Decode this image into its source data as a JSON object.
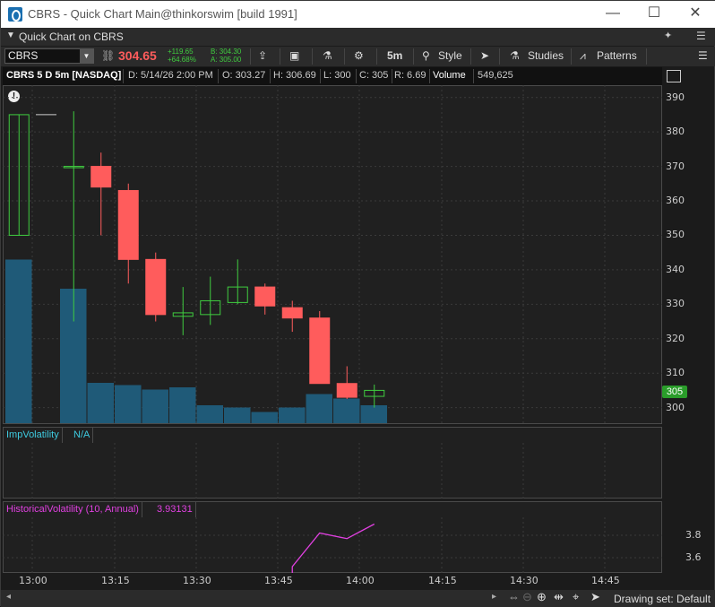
{
  "window": {
    "title": "CBRS - Quick Chart Main@thinkorswim [build 1991]",
    "minimize": "—",
    "maximize": "☐",
    "close": "✕"
  },
  "subbar": {
    "label": "Quick Chart on CBRS",
    "pin": "✦",
    "menu": "☰"
  },
  "toolbar": {
    "symbol": "CBRS",
    "last_price": "304.65",
    "change": "+119.65",
    "change_pct": "+64.68%",
    "bid": "B: 304.30",
    "ask": "A: 305.00",
    "timeframe": "5m",
    "style_label": "Style",
    "studies_label": "Studies",
    "patterns_label": "Patterns"
  },
  "infobar": {
    "symbol_desc": "CBRS 5 D 5m [NASDAQ]",
    "date": "D: 5/14/26 2:00 PM",
    "open": "O: 303.27",
    "high": "H: 306.69",
    "low": "L: 300",
    "close": "C: 305",
    "range": "R: 6.69",
    "volume_label": "Volume",
    "volume_value": "549,625"
  },
  "price_axis": {
    "ticks": [
      "390",
      "380",
      "370",
      "360",
      "350",
      "340",
      "330",
      "320",
      "310",
      "300"
    ],
    "current_badge": "305"
  },
  "study1": {
    "name": "ImpVolatility",
    "value": "N/A"
  },
  "study2": {
    "name": "HistoricalVolatility (10, Annual)",
    "value": "3.93131",
    "ticks": [
      "3.8",
      "3.6"
    ]
  },
  "x_axis": {
    "ticks": [
      "13:00",
      "13:15",
      "13:30",
      "13:45",
      "14:00",
      "14:15",
      "14:30",
      "14:45"
    ]
  },
  "statusbar": {
    "drawing_set": "Drawing set: Default"
  },
  "colors": {
    "up": "#3fcc3f",
    "down": "#ff5c5c",
    "volume": "#1f5a78",
    "hv_line": "#e040e0",
    "study1_label": "#3ecbe0",
    "study2_label": "#e040e0"
  },
  "chart_data": {
    "type": "candlestick",
    "price_ylim": [
      296,
      392
    ],
    "candles": [
      {
        "time": "12:55",
        "open": 350,
        "high": 385,
        "low": 350,
        "close": 385
      },
      {
        "time": "13:05",
        "open": 370,
        "high": 386,
        "low": 325,
        "close": 370
      },
      {
        "time": "13:10",
        "open": 370,
        "high": 374,
        "low": 350,
        "close": 364
      },
      {
        "time": "13:15",
        "open": 363,
        "high": 365,
        "low": 336,
        "close": 343
      },
      {
        "time": "13:20",
        "open": 343,
        "high": 345,
        "low": 325,
        "close": 327
      },
      {
        "time": "13:25",
        "open": 326.5,
        "high": 335,
        "low": 321,
        "close": 327.5
      },
      {
        "time": "13:30",
        "open": 327,
        "high": 338,
        "low": 324,
        "close": 331
      },
      {
        "time": "13:35",
        "open": 330.5,
        "high": 343,
        "low": 330,
        "close": 335
      },
      {
        "time": "13:40",
        "open": 335,
        "high": 336,
        "low": 327,
        "close": 329.5
      },
      {
        "time": "13:45",
        "open": 329,
        "high": 331,
        "low": 322,
        "close": 326
      },
      {
        "time": "13:50",
        "open": 326,
        "high": 328,
        "low": 307,
        "close": 307
      },
      {
        "time": "13:55",
        "open": 307,
        "high": 312,
        "low": 302.5,
        "close": 303
      },
      {
        "time": "14:00",
        "open": 303.27,
        "high": 306.69,
        "low": 300,
        "close": 305
      }
    ],
    "volume": [
      0.73,
      0,
      0.6,
      0.18,
      0.17,
      0.15,
      0.16,
      0.08,
      0.07,
      0.05,
      0.07,
      0.13,
      0.11,
      0.08
    ],
    "hv_series": [
      {
        "time": "13:45",
        "value": 3.52
      },
      {
        "time": "13:50",
        "value": 3.82
      },
      {
        "time": "13:55",
        "value": 3.77
      },
      {
        "time": "14:00",
        "value": 3.9
      }
    ],
    "hv_ylim": [
      3.5,
      3.93
    ]
  }
}
